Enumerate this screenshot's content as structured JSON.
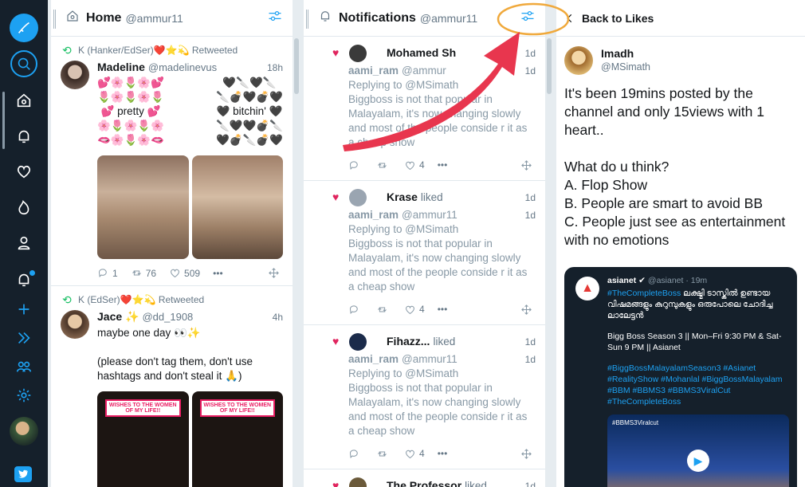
{
  "columns": {
    "home": {
      "num": "1",
      "title": "Home",
      "handle": "@ammur11"
    },
    "notif": {
      "num": "2",
      "title": "Notifications",
      "handle": "@ammur11"
    },
    "detail": {
      "back": "Back to Likes"
    }
  },
  "home_tweets": [
    {
      "rt": "K (Hanker/EdSer)❤️⭐💫 Retweeted",
      "name": "Madeline",
      "handle": "@madelinevus",
      "time": "18h",
      "text_left": "💕🌸🌷🌸💕\n🌷🌸🌷🌸🌷\n💕 pretty 💕\n🌸🌷🌸🌷🌸\n🫦🌸🌷🌸🫦",
      "text_right": "🖤🔪🖤🔪\n🔪💣🖤💣🖤\n🖤 bitchin' 🖤\n🔪🖤🖤💣🔪\n🖤💣🔪💣🖤",
      "replies": "1",
      "retweets": "76",
      "likes": "509"
    },
    {
      "rt": "K (EdSer)❤️⭐💫 Retweeted",
      "name": "Jace ✨",
      "handle": "@dd_1908",
      "time": "4h",
      "text": "maybe one day 👀✨\n\n(please don't tag them, don't use hashtags and don't steal it 🙏)",
      "banner": "WISHES TO THE WOMEN OF MY LIFE!!"
    }
  ],
  "notifications": [
    {
      "name": "Mohamed Sh",
      "verb": "",
      "time": "1d",
      "user": "aami_ram",
      "user_handle": "@ammur",
      "time2": "1d",
      "reply": "Replying to @MSimath",
      "body": "Biggboss is not that popular in Malayalam, it's now changing slowly and most of the people conside r it as a cheap show",
      "likes": "4"
    },
    {
      "name": "Krase",
      "verb": "liked",
      "time": "1d",
      "user": "aami_ram",
      "user_handle": "@ammur11",
      "time2": "1d",
      "reply": "Replying to @MSimath",
      "body": "Biggboss is not that popular in Malayalam, it's now changing slowly and most of the people conside r it as a cheap show",
      "likes": "4"
    },
    {
      "name": "Fihazz...",
      "verb": "liked",
      "time": "1d",
      "user": "aami_ram",
      "user_handle": "@ammur11",
      "time2": "1d",
      "reply": "Replying to @MSimath",
      "body": "Biggboss is not that popular in Malayalam, it's now changing slowly and most of the people conside r it as a cheap show",
      "likes": "4"
    },
    {
      "name": "The Professor",
      "verb": "liked",
      "time": "1d"
    }
  ],
  "detail": {
    "name": "Imadh",
    "handle": "@MSimath",
    "text": "It's been 19mins posted by the channel and only 15views with 1 heart..\n\nWhat do u think?\nA. Flop Show\nB. People are smart to avoid BB\nC. People just see as entertainment with no emotions",
    "quote": {
      "name": "asianet",
      "handle": "@asianet · 19m",
      "hash1": "#TheCompleteBoss",
      "mal1": "ലക്ഷ്മി ടാസ്കിൽ ഉണ്ടായ വിഷമങ്ങളും കുറുമ്പുകളും ഒരുപോലെ ചോദിച്ച ലാലേട്ടൻ",
      "line2": "Bigg Boss Season 3 || Mon–Fri 9:30 PM & Sat-Sun 9 PM || Asianet",
      "hashes": "#BiggBossMalayalamSeason3 #Asianet #RealityShow #Mohanlal #BiggBossMalayalam #BBM #BBMS3 #BBMS3ViralCut #TheCompleteBoss",
      "video_label": "#BBMS3Viralcut"
    }
  }
}
